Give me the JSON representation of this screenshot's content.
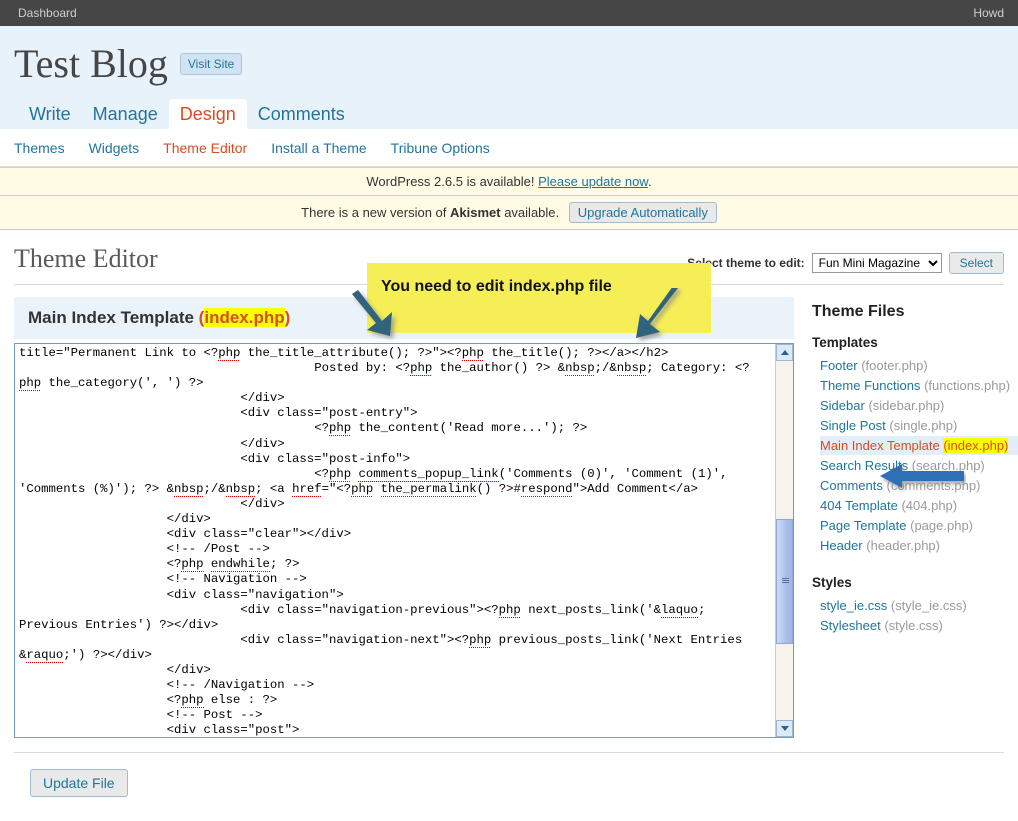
{
  "admin_bar": {
    "dashboard_label": "Dashboard",
    "howdy_label": "Howd"
  },
  "blog_header": {
    "title": "Test Blog",
    "visit_site_label": "Visit Site"
  },
  "primary_nav": {
    "items": [
      {
        "label": "Write",
        "active": false
      },
      {
        "label": "Manage",
        "active": false
      },
      {
        "label": "Design",
        "active": true
      },
      {
        "label": "Comments",
        "active": false
      }
    ]
  },
  "secondary_nav": {
    "items": [
      {
        "label": "Themes",
        "active": false
      },
      {
        "label": "Widgets",
        "active": false
      },
      {
        "label": "Theme Editor",
        "active": true
      },
      {
        "label": "Install a Theme",
        "active": false
      },
      {
        "label": "Tribune Options",
        "active": false
      }
    ]
  },
  "notices": {
    "wordpress_update": {
      "text_before": "WordPress 2.6.5 is available! ",
      "link": "Please update now",
      "text_after": "."
    },
    "akismet": {
      "text_before": "There is a new version of ",
      "name": "Akismet",
      "text_after": " available.",
      "button": "Upgrade Automatically"
    }
  },
  "page": {
    "title": "Theme Editor",
    "select_theme_label": "Select theme to edit:",
    "selected_theme": "Fun Mini Magazine",
    "theme_options": [
      "Fun Mini Magazine"
    ],
    "select_button": "Select"
  },
  "editor": {
    "file_heading_name": "Main Index Template",
    "file_heading_open_paren": " (",
    "file_heading_file": "index.php",
    "file_heading_close_paren": ")",
    "update_button": "Update File",
    "code": "title=\"Permanent Link to <?php the_title_attribute(); ?>\"><?php the_title(); ?></a></h2>\n                                        Posted by: <?php the_author() ?> &nbsp;/&nbsp; Category: <?php the_category(', ') ?>\n                              </div>\n                              <div class=\"post-entry\">\n                                        <?php the_content('Read more...'); ?>\n                              </div>\n                              <div class=\"post-info\">\n                                        <?php comments_popup_link('Comments (0)', 'Comment (1)', 'Comments (%)'); ?> &nbsp;/&nbsp; <a href=\"<?php the_permalink() ?>#respond\">Add Comment</a>\n                              </div>\n                    </div>\n                    <div class=\"clear\"></div>\n                    <!-- /Post -->\n                    <?php endwhile; ?>\n                    <!-- Navigation -->\n                    <div class=\"navigation\">\n                              <div class=\"navigation-previous\"><?php next_posts_link('&laquo; Previous Entries') ?></div>\n                              <div class=\"navigation-next\"><?php previous_posts_link('Next Entries &raquo;') ?></div>\n                    </div>\n                    <!-- /Navigation -->\n                    <?php else : ?>\n                    <!-- Post -->\n                    <div class=\"post\">"
  },
  "theme_files": {
    "heading": "Theme Files",
    "templates_heading": "Templates",
    "templates": [
      {
        "label": "Footer",
        "slug": "(footer.php)",
        "current": false
      },
      {
        "label": "Theme Functions",
        "slug": "(functions.php)",
        "current": false
      },
      {
        "label": "Sidebar",
        "slug": "(sidebar.php)",
        "current": false
      },
      {
        "label": "Single Post",
        "slug": "(single.php)",
        "current": false
      },
      {
        "label": "Main Index Template",
        "slug": "(index.php)",
        "current": true
      },
      {
        "label": "Search Results",
        "slug": "(search.php)",
        "current": false
      },
      {
        "label": "Comments",
        "slug": "(comments.php)",
        "current": false
      },
      {
        "label": "404 Template",
        "slug": "(404.php)",
        "current": false
      },
      {
        "label": "Page Template",
        "slug": "(page.php)",
        "current": false
      },
      {
        "label": "Header",
        "slug": "(header.php)",
        "current": false
      }
    ],
    "styles_heading": "Styles",
    "styles": [
      {
        "label": "style_ie.css",
        "slug": "(style_ie.css)"
      },
      {
        "label": "Stylesheet",
        "slug": "(style.css)"
      }
    ]
  },
  "annotation": {
    "callout_text": "You need to edit index.php file",
    "highlight_color": "#f5ee56",
    "arrow_color": "#33647d"
  }
}
